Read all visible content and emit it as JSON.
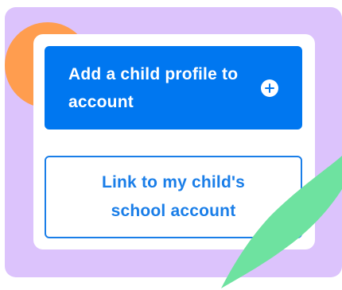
{
  "buttons": {
    "add_child_profile": {
      "label": "Add a child profile to account",
      "icon": "plus-circle-icon"
    },
    "link_school_account": {
      "label": "Link to my child's school account"
    }
  },
  "colors": {
    "background_panel": "#dcc3fc",
    "orange_accent": "#ff9d4f",
    "primary_blue": "#0077f0",
    "outline_blue": "#1a7ee8",
    "green_accent": "#6ee2a0",
    "card": "#ffffff"
  }
}
